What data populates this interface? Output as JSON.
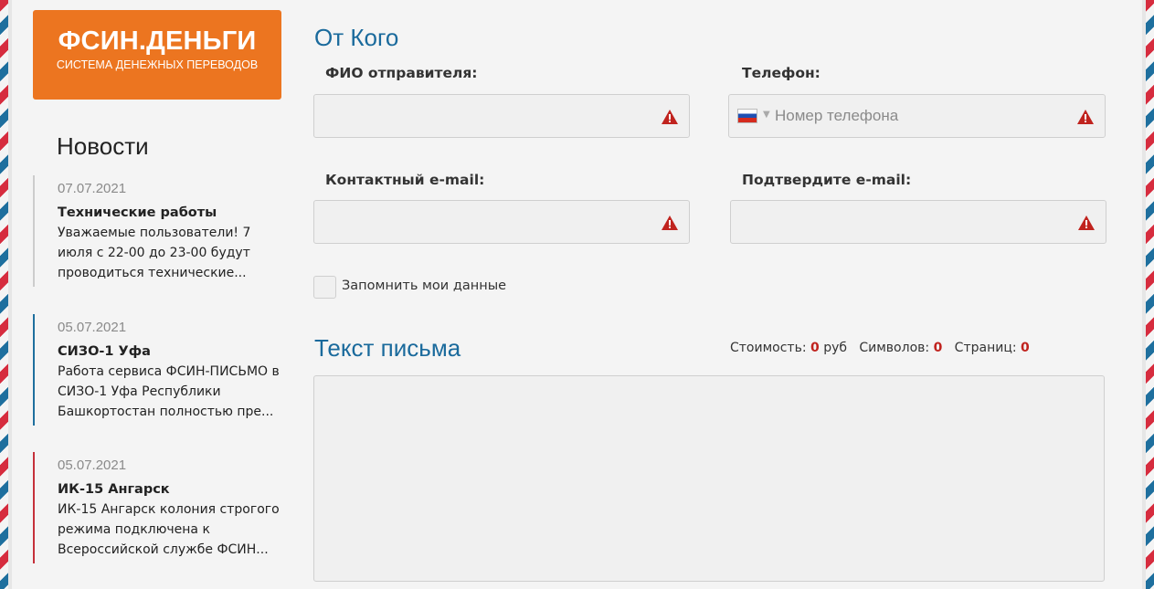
{
  "logo": {
    "title": "ФСИН.ДЕНЬГИ",
    "subtitle": "СИСТЕМА ДЕНЕЖНЫХ ПЕРЕВОДОВ"
  },
  "news": {
    "heading": "Новости",
    "items": [
      {
        "date": "07.07.2021",
        "title": "Технические работы",
        "text": "Уважаемые пользователи! 7 июля с 22-00 до 23-00 будут проводиться технические..."
      },
      {
        "date": "05.07.2021",
        "title": "СИЗО-1 Уфа",
        "text": "Работа сервиса ФСИН-ПИСЬМО в СИЗО-1 Уфа Республики Башкортостан полностью пре..."
      },
      {
        "date": "05.07.2021",
        "title": "ИК-15 Ангарск",
        "text": "ИК-15 Ангарск колония строгого режима подключена к Всероссийской службе ФСИН..."
      }
    ]
  },
  "sender": {
    "section_title": "От Кого",
    "fio_label": "ФИО отправителя:",
    "fio_value": "",
    "phone_label": "Телефон:",
    "phone_placeholder": "Номер телефона",
    "email_label": "Контактный e-mail:",
    "email_value": "",
    "confirm_email_label": "Подтвердите e-mail:",
    "confirm_email_value": "",
    "remember_label": "Запомнить мои данные",
    "remember_checked": false
  },
  "letter": {
    "section_title": "Текст письма",
    "cost_label": "Стоимость:",
    "cost_value": "0",
    "cost_unit": "руб",
    "chars_label": "Символов:",
    "chars_value": "0",
    "pages_label": "Страниц:",
    "pages_value": "0",
    "body": ""
  },
  "colors": {
    "accent_orange": "#ec7520",
    "heading_blue": "#1a6a9c",
    "warning_red": "#c0231e"
  },
  "icons": {
    "warning": "warning-triangle-icon",
    "flag": "russia-flag-icon"
  }
}
